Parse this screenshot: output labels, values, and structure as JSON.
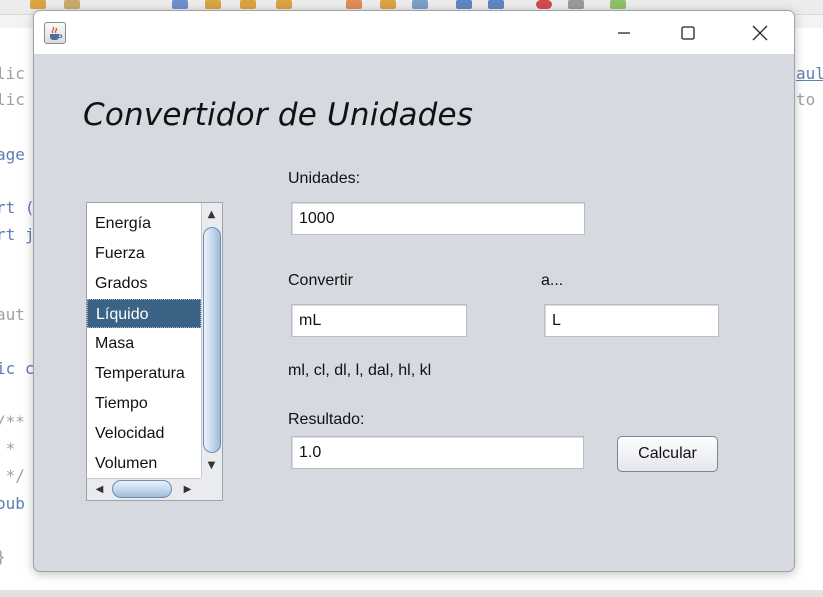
{
  "ide": {
    "code_lines": [
      "lic",
      "lic",
      "age",
      "rt (",
      "rt j",
      "aut",
      "ic c",
      "/**",
      " * ",
      " */",
      "oub",
      "}"
    ],
    "right_fragments": [
      "aul",
      "to"
    ]
  },
  "window": {
    "heading": "Convertidor de Unidades",
    "units_label": "Unidades:",
    "units_value": "1000",
    "convert_label": "Convertir",
    "to_label": "a...",
    "from_value": "mL",
    "to_value": "L",
    "hint": "ml, cl, dl, l, dal, hl, kl",
    "result_label": "Resultado:",
    "result_value": "1.0",
    "calc_button": "Calcular",
    "list": {
      "items": [
        "Energía",
        "Fuerza",
        "Grados",
        "Líquido",
        "Masa",
        "Temperatura",
        "Tiempo",
        "Velocidad",
        "Volumen"
      ],
      "selected": "Líquido"
    }
  },
  "colors": {
    "window_bg": "#d6d9e0",
    "selection": "#3b6385",
    "scroll_thumb": "#c3d6ec"
  }
}
